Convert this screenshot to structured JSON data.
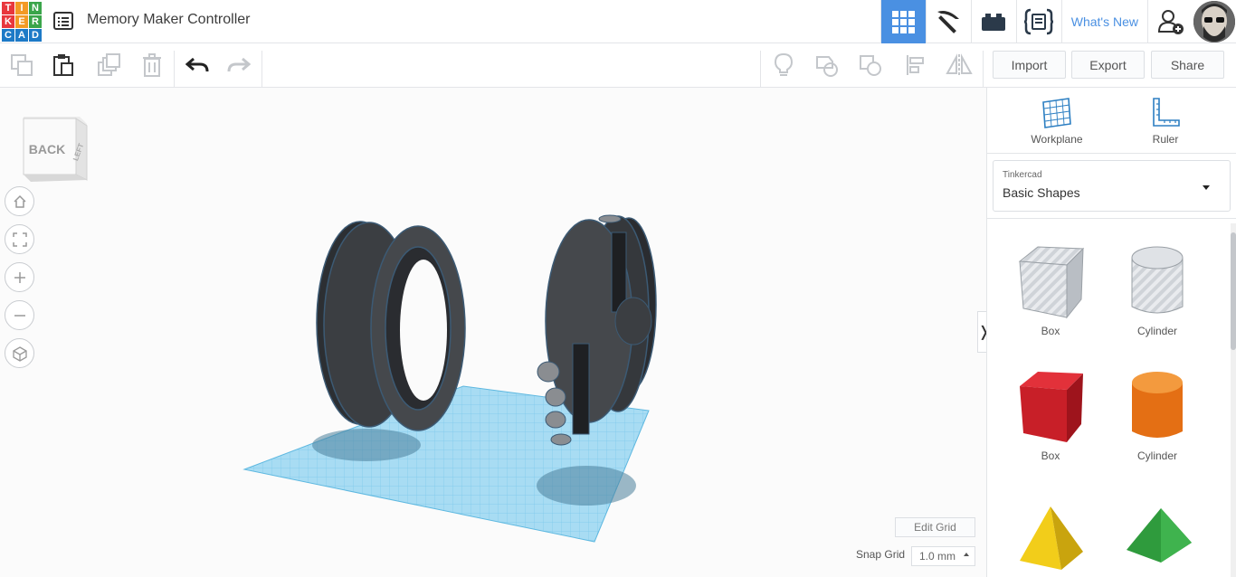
{
  "app": {
    "logo_letters": [
      "T",
      "I",
      "N",
      "K",
      "E",
      "R",
      "C",
      "A",
      "D"
    ],
    "logo_colors": [
      "#e8373d",
      "#f39a25",
      "#3aa54a",
      "#e8373d",
      "#f39a25",
      "#3aa54a",
      "#1d7ac7",
      "#1d7ac7",
      "#1d7ac7"
    ],
    "document_title": "Memory Maker Controller"
  },
  "topnav": {
    "items": [
      {
        "name": "3d-design-grid-icon",
        "active": true
      },
      {
        "name": "pickaxe-icon",
        "active": false
      },
      {
        "name": "bricks-icon",
        "active": false
      },
      {
        "name": "codeblocks-icon",
        "active": false
      }
    ],
    "whats_new": "What's New",
    "accent_color": "#4a90e2"
  },
  "toolbar": {
    "import_label": "Import",
    "export_label": "Export",
    "share_label": "Share"
  },
  "viewport": {
    "viewcube_front": "BACK",
    "viewcube_side": "LEFT",
    "edit_grid_label": "Edit Grid",
    "snap_grid_label": "Snap Grid",
    "snap_grid_value": "1.0 mm"
  },
  "panel": {
    "tools": [
      {
        "label": "Workplane",
        "icon": "workplane-icon"
      },
      {
        "label": "Ruler",
        "icon": "ruler-icon"
      }
    ],
    "library_provider": "Tinkercad",
    "library_name": "Basic Shapes",
    "shapes": [
      {
        "label": "Box",
        "style": "hole"
      },
      {
        "label": "Cylinder",
        "style": "hole"
      },
      {
        "label": "Box",
        "style": "solid",
        "color": "#d01f27"
      },
      {
        "label": "Cylinder",
        "style": "solid",
        "color": "#e7771d"
      },
      {
        "label": "",
        "style": "solid",
        "color": "#f2cd1a"
      },
      {
        "label": "",
        "style": "solid",
        "color": "#2f9b3d"
      }
    ]
  }
}
